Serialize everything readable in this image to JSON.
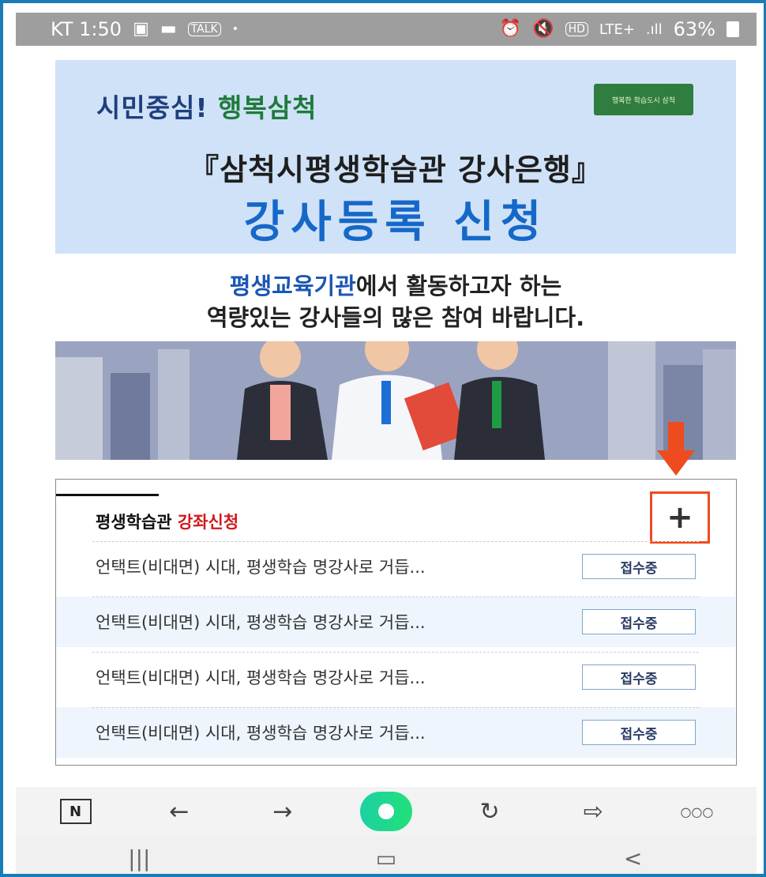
{
  "status_bar": {
    "carrier_time": "KT 1:50",
    "battery": "63%",
    "talk": "TALK",
    "hd": "HD",
    "lte": "LTE+"
  },
  "banner": {
    "slogan_part1": "시민중심!",
    "slogan_part2": "행복삼척",
    "title": "『삼척시평생학습관 강사은행』",
    "headline": "강사등록 신청",
    "badge_text": "행복한 학습도시 삼척"
  },
  "message": {
    "line1_highlight": "평생교육기관",
    "line1_rest": "에서 활동하고자 하는",
    "line2": "역량있는 강사들의 많은 참여 바랍니다."
  },
  "panel": {
    "title_part1": "평생학습관",
    "title_part2": "강좌신청",
    "plus_label": "+",
    "rows": [
      {
        "text": "언택트(비대면) 시대, 평생학습 명강사로 거듭...",
        "status": "접수중"
      },
      {
        "text": "언택트(비대면) 시대, 평생학습 명강사로 거듭...",
        "status": "접수중"
      },
      {
        "text": "언택트(비대면) 시대, 평생학습 명강사로 거듭...",
        "status": "접수중"
      },
      {
        "text": "언택트(비대면) 시대, 평생학습 명강사로 거듭...",
        "status": "접수중"
      }
    ]
  },
  "toolbar": {
    "naver": "N",
    "back": "←",
    "forward": "→",
    "refresh": "↻",
    "share": "⇨",
    "more": "○○○"
  },
  "navbar": {
    "recent": "|||",
    "home": "▭",
    "back": "<"
  },
  "colors": {
    "accent_red": "#d0191e",
    "highlight_orange": "#ee4b1e",
    "banner_bg": "#cfe2f7",
    "headline_blue": "#1668c8"
  }
}
